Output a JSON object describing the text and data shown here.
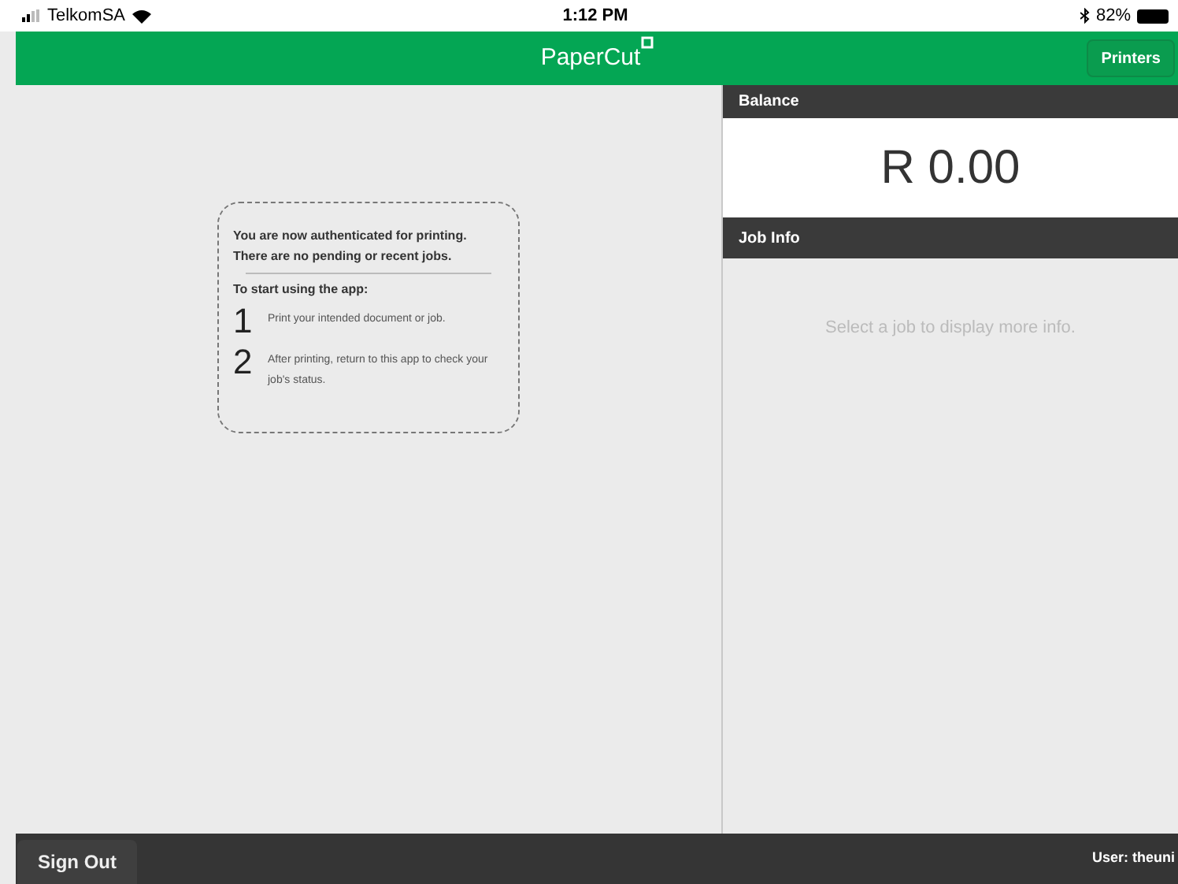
{
  "status_bar": {
    "carrier": "TelkomSA",
    "time": "1:12 PM",
    "battery": "82%"
  },
  "header": {
    "logo": "PaperCut",
    "button": "Printers"
  },
  "message": {
    "lines": [
      "You are now authenticated for printing.",
      "There are no pending or recent jobs."
    ],
    "intro": "To start using the app:",
    "steps": [
      {
        "number": "1",
        "text": "Print your intended document or job."
      },
      {
        "number": "2",
        "text": "After printing, return to this app to check your job's status."
      }
    ]
  },
  "balance": {
    "title": "Balance",
    "amount": "R 0.00"
  },
  "job_info": {
    "title": "Job Info",
    "empty": "Select a job to display more info."
  },
  "footer": {
    "button": "Sign Out",
    "user": "User: theuni"
  }
}
